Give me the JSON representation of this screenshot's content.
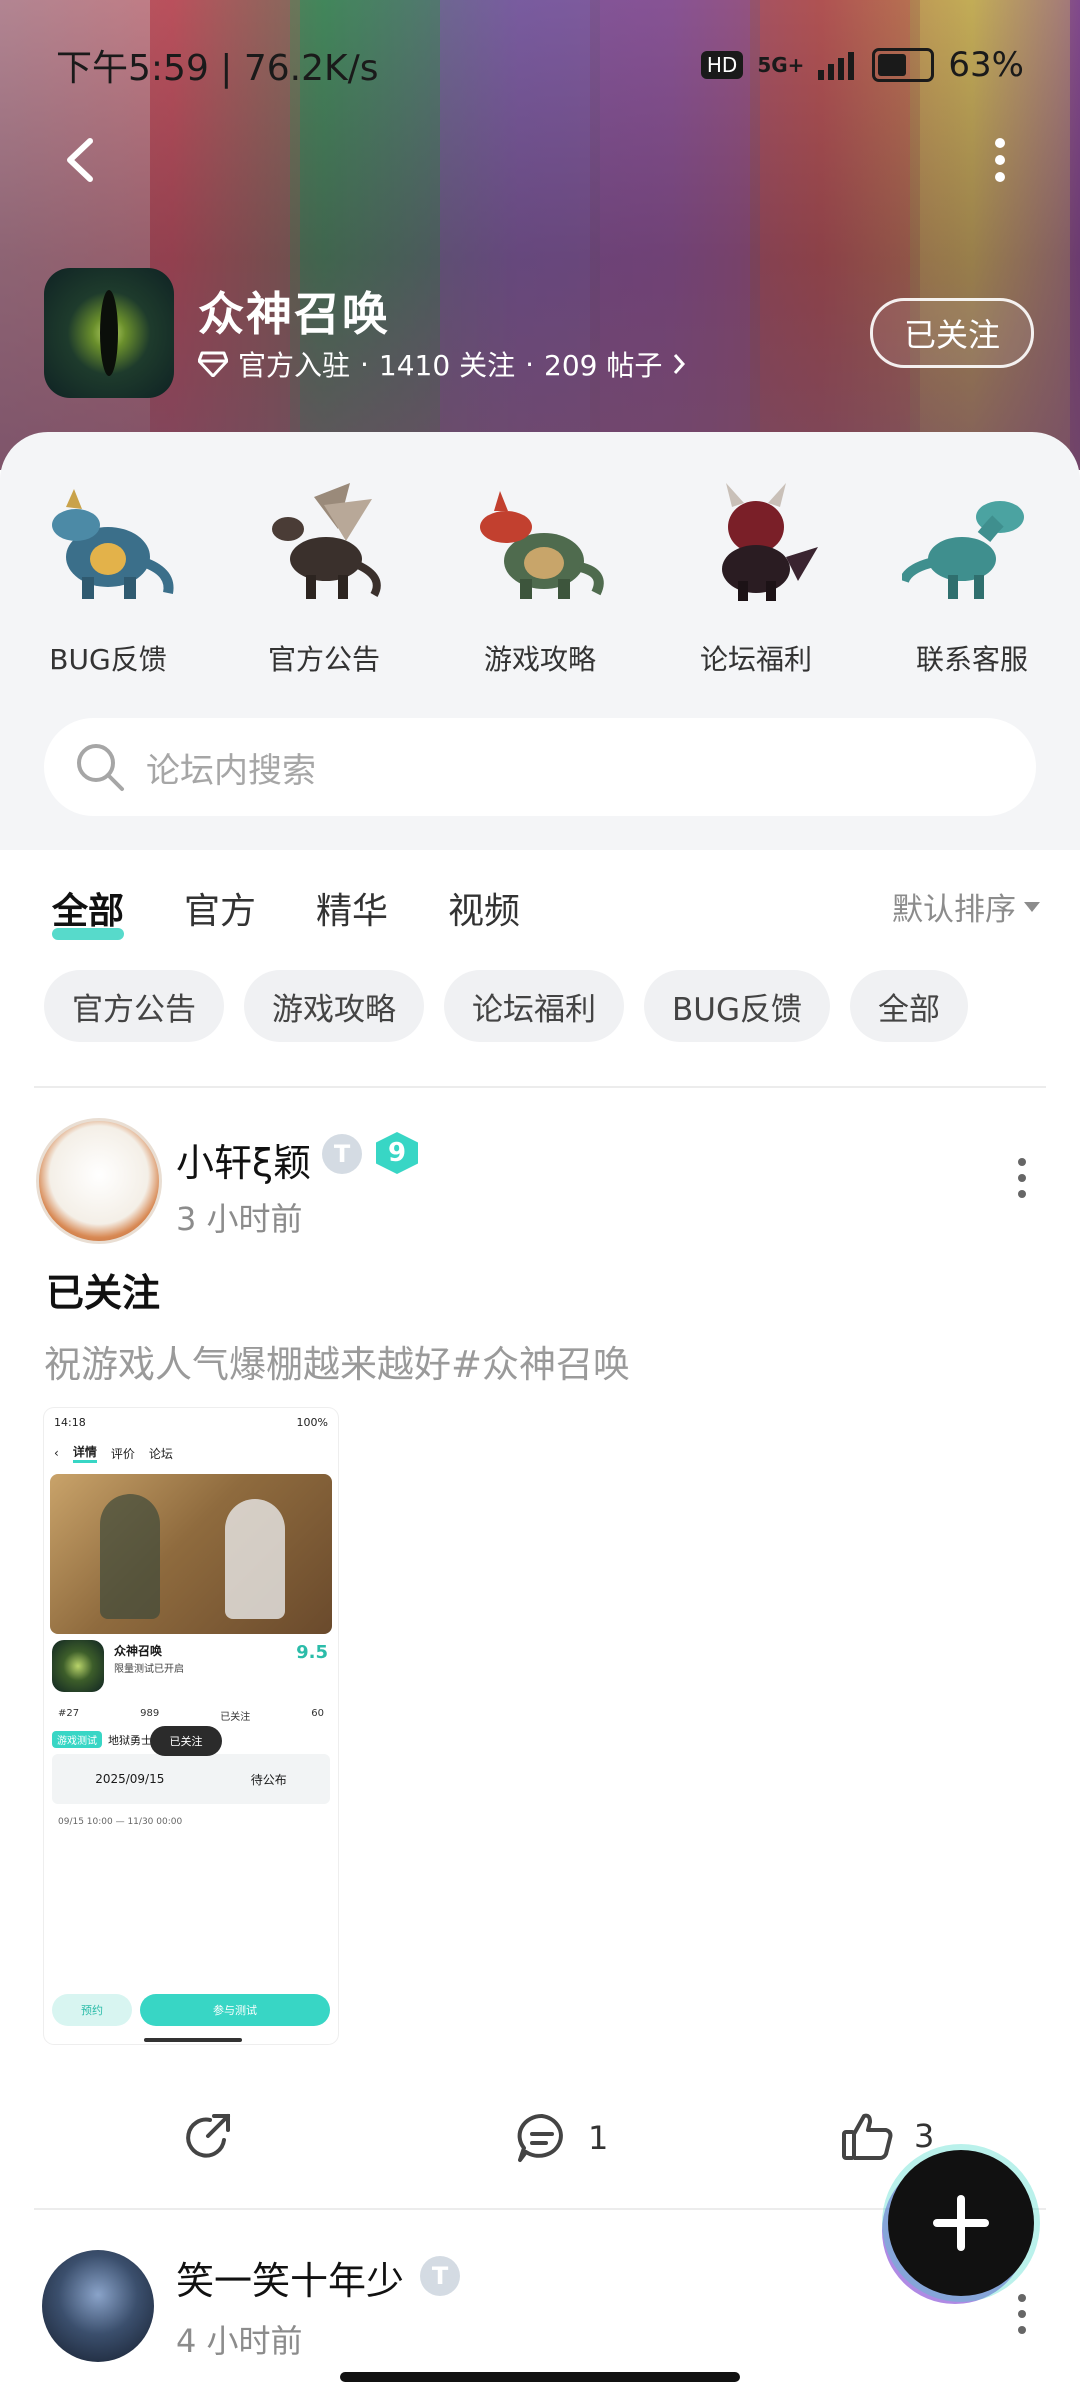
{
  "status_bar": {
    "time_speed": "下午5:59 | 76.2K/s",
    "hd": "HD",
    "network": "5G+",
    "battery": "63%",
    "battery_level": 0.63
  },
  "forum": {
    "name": "众神召唤",
    "official": "官方入驻",
    "followers": "1410 关注",
    "posts": "209 帖子",
    "follow_label": "已关注"
  },
  "categories": [
    {
      "label": "BUG反馈",
      "icon": "blue-dragon-icon"
    },
    {
      "label": "官方公告",
      "icon": "winged-dragon-icon"
    },
    {
      "label": "游戏攻略",
      "icon": "red-dragon-icon"
    },
    {
      "label": "论坛福利",
      "icon": "dark-dragon-icon"
    },
    {
      "label": "联系客服",
      "icon": "teal-dinosaur-icon"
    }
  ],
  "search": {
    "placeholder": "论坛内搜索"
  },
  "tabs": [
    "全部",
    "官方",
    "精华",
    "视频"
  ],
  "sort_label": "默认排序",
  "chips": [
    "官方公告",
    "游戏攻略",
    "论坛福利",
    "BUG反馈",
    "全部"
  ],
  "post1": {
    "author": "小轩ξ颖",
    "badge_t": "T",
    "level": "9",
    "time": "3 小时前",
    "title": "已关注",
    "body": "祝游戏人气爆棚越来越好#众神召唤",
    "screenshot": {
      "time": "14:18",
      "battery": "100%",
      "tabs": [
        "详情",
        "评价",
        "论坛"
      ],
      "app_name": "众神召唤",
      "app_sub": "限量测试已开启",
      "score": "9.5",
      "stats": [
        "#27",
        "989",
        "已关注",
        "60"
      ],
      "toast": "已关注",
      "tag": "游戏测试",
      "tag_name": "地狱勇士",
      "date": "2025/09/15",
      "date_end": "待公布",
      "info": "09/15 10:00 — 11/30 00:00",
      "btn1": "预约",
      "btn2": "参与测试"
    },
    "comments": "1",
    "likes": "3"
  },
  "post2": {
    "author": "笑一笑十年少",
    "badge_t": "T",
    "time": "4 小时前"
  },
  "colors": {
    "accent": "#38d6c5",
    "text_secondary": "#8c8c8c"
  }
}
